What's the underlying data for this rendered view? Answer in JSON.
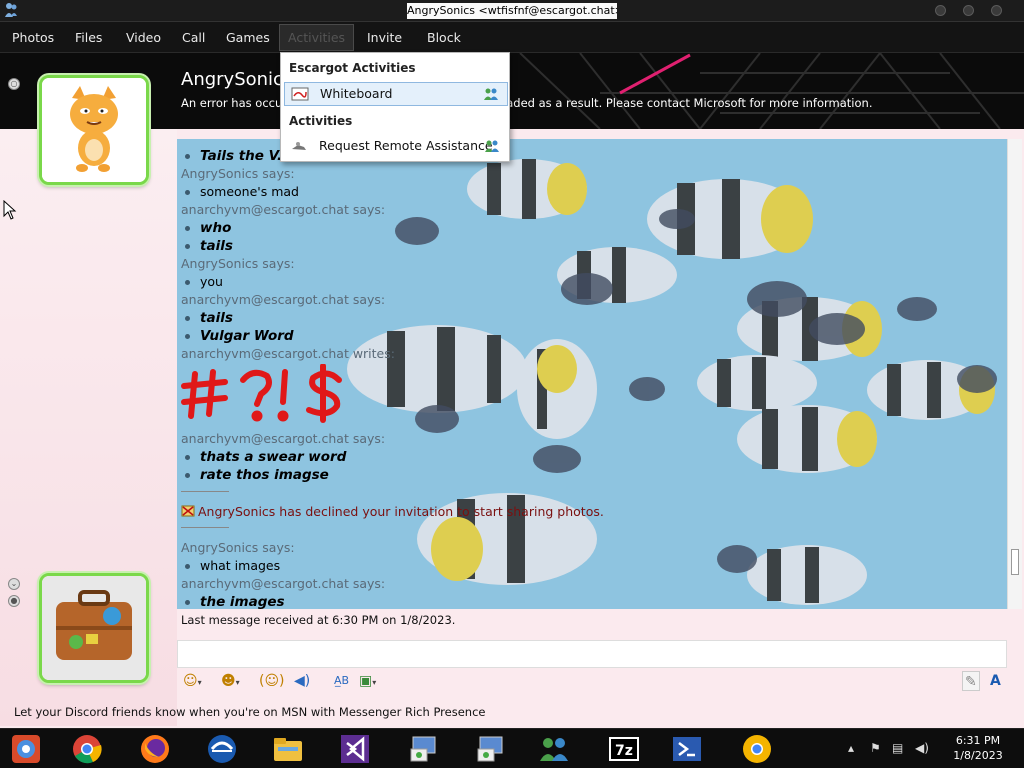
{
  "window": {
    "title": "AngrySonics <wtfisfnf@escargot.chat>"
  },
  "menu": {
    "photos": "Photos",
    "files": "Files",
    "video": "Video",
    "call": "Call",
    "games": "Games",
    "activities": "Activities",
    "invite": "Invite",
    "block": "Block"
  },
  "header": {
    "contact_name": "AngrySonics",
    "error_text": "An error has occurred and some features could not be loaded as a result. Please contact Microsoft for more information."
  },
  "dropdown": {
    "section1": "Escargot Activities",
    "item1": "Whiteboard",
    "section2": "Activities",
    "item2": "Request Remote Assistance"
  },
  "chat": {
    "lines": [
      {
        "kind": "msg_bi",
        "text": "Tails the V..."
      },
      {
        "kind": "says",
        "text": "AngrySonics says:"
      },
      {
        "kind": "msg",
        "text": "someone's mad"
      },
      {
        "kind": "says",
        "text": "anarchyvm@escargot.chat says:"
      },
      {
        "kind": "msg_bi",
        "text": "who"
      },
      {
        "kind": "msg_bi",
        "text": "tails"
      },
      {
        "kind": "says",
        "text": "AngrySonics says:"
      },
      {
        "kind": "msg",
        "text": "you"
      },
      {
        "kind": "says",
        "text": "anarchyvm@escargot.chat says:"
      },
      {
        "kind": "msg_bi",
        "text": "tails"
      },
      {
        "kind": "msg_bi",
        "text": "Vulgar Word"
      },
      {
        "kind": "says",
        "text": "anarchyvm@escargot.chat writes:"
      },
      {
        "kind": "says",
        "text": "anarchyvm@escargot.chat says:"
      },
      {
        "kind": "msg_bi",
        "text": "thats a swear word"
      },
      {
        "kind": "msg_bi",
        "text": "rate thos imagse"
      },
      {
        "kind": "says",
        "text": "AngrySonics says:"
      },
      {
        "kind": "msg",
        "text": "what images"
      },
      {
        "kind": "says",
        "text": "anarchyvm@escargot.chat says:"
      },
      {
        "kind": "msg_bi",
        "text": "the images"
      }
    ],
    "handwriting": "#?!$",
    "system_message": "AngrySonics has declined your invitation to start sharing photos."
  },
  "status": {
    "last_message": "Last message received at 6:30 PM on 1/8/2023."
  },
  "promo": {
    "text": "Let your Discord friends know when you're on MSN with Messenger Rich Presence"
  },
  "clock": {
    "time": "6:31 PM",
    "date": "1/8/2023"
  },
  "colors": {
    "accent_green": "#7ad84a",
    "error_red": "#7a1010",
    "handwriting_red": "#e01818"
  },
  "icons": [
    "messenger-icon",
    "whiteboard-icon",
    "remote-assistance-icon",
    "people-icon",
    "smiley-icon",
    "wink-icon",
    "nudge-icon",
    "voice-clip-icon",
    "font-icon",
    "background-icon",
    "pencil-icon",
    "text-a-icon",
    "cursor-icon"
  ]
}
